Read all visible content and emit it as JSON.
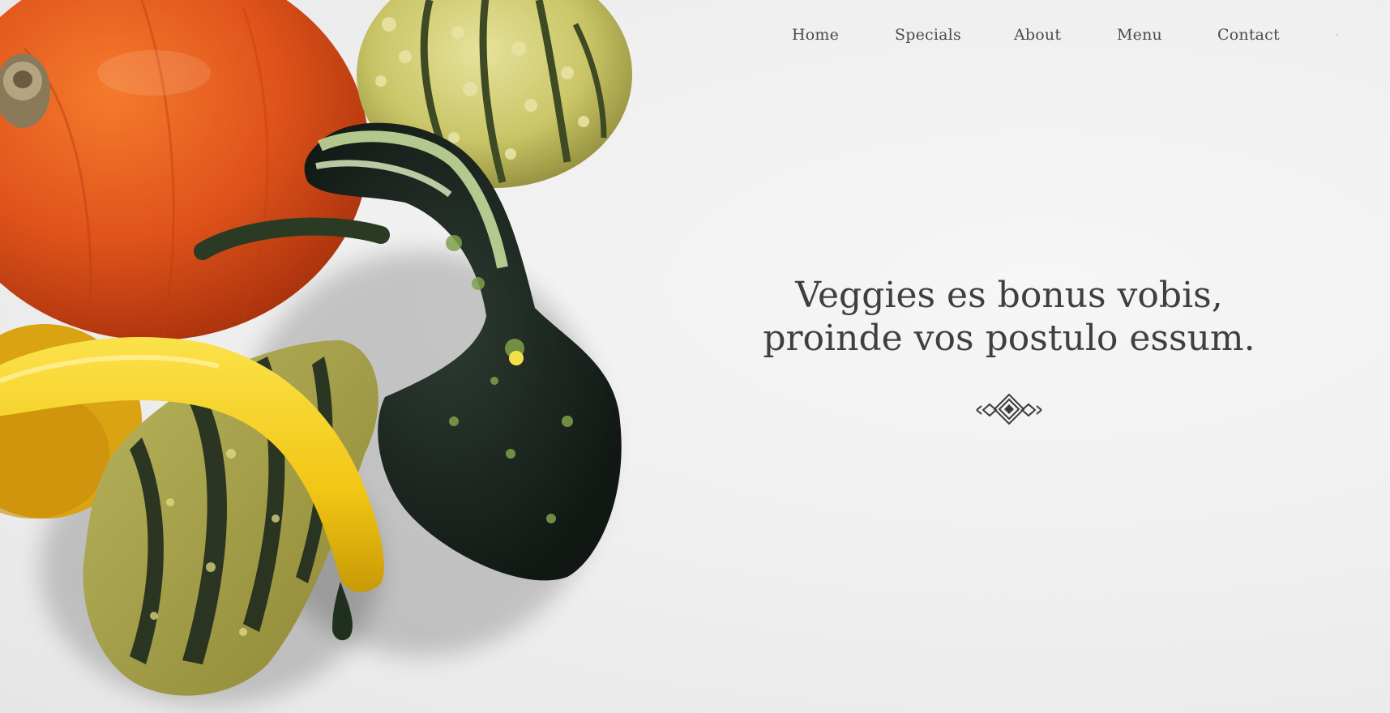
{
  "nav": {
    "items": [
      {
        "label": "Home"
      },
      {
        "label": "Specials"
      },
      {
        "label": "About"
      },
      {
        "label": "Menu"
      },
      {
        "label": "Contact"
      }
    ]
  },
  "hero": {
    "headline_line1": "Veggies es bonus vobis,",
    "headline_line2": "proinde vos postulo essum.",
    "divider_icon": "ornamental-diamond-divider",
    "image": "gourds-and-pumpkin-photo"
  },
  "colors": {
    "background": "#f0f0f0",
    "text": "#3f3f3f",
    "nav_text": "#4a4a4a",
    "pumpkin": "#e0531b",
    "squash_yellow": "#f2c614",
    "gourd_green": "#1e2a22",
    "gourd_light": "#c9c567"
  }
}
